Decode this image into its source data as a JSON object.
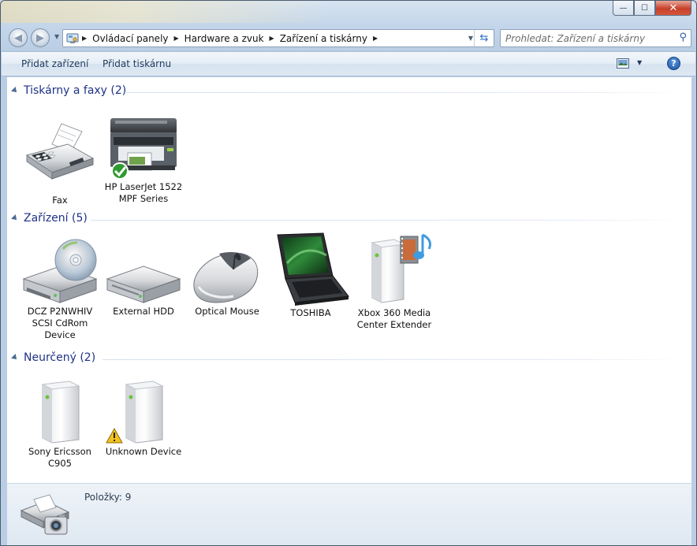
{
  "window": {
    "controls": {
      "minimize": "—",
      "maximize": "☐",
      "close": "✕"
    }
  },
  "nav": {
    "breadcrumbs": [
      "Ovládací panely",
      "Hardware a zvuk",
      "Zařízení a tiskárny"
    ],
    "search_placeholder": "Prohledat: Zařízení a tiskárny"
  },
  "toolbar": {
    "add_device": "Přidat zařízení",
    "add_printer": "Přidat tiskárnu",
    "help": "?"
  },
  "groups": [
    {
      "title": "Tiskárny a faxy (2)",
      "items": [
        {
          "label": "Fax",
          "icon": "fax-icon"
        },
        {
          "label": "HP LaserJet 1522 MPF Series",
          "icon": "printer-icon",
          "badge": "default-check"
        }
      ]
    },
    {
      "title": "Zařízení (5)",
      "items": [
        {
          "label": "DCZ P2NWHIV SCSI CdRom Device",
          "icon": "cdrom-drive-icon"
        },
        {
          "label": "External HDD",
          "icon": "hard-drive-icon"
        },
        {
          "label": "Optical Mouse",
          "icon": "mouse-icon"
        },
        {
          "label": "TOSHIBA",
          "icon": "laptop-icon"
        },
        {
          "label": "Xbox 360 Media Center Extender",
          "icon": "media-extender-icon"
        }
      ]
    },
    {
      "title": "Neurčený (2)",
      "items": [
        {
          "label": "Sony Ericsson C905",
          "icon": "generic-device-icon"
        },
        {
          "label": "Unknown Device",
          "icon": "generic-device-icon",
          "badge": "warning"
        }
      ]
    }
  ],
  "details": {
    "count_text": "Položky: 9"
  },
  "colors": {
    "group_title": "#1e3287",
    "toolbar_text": "#1e395b",
    "window_frame": "#c4d6ea"
  }
}
